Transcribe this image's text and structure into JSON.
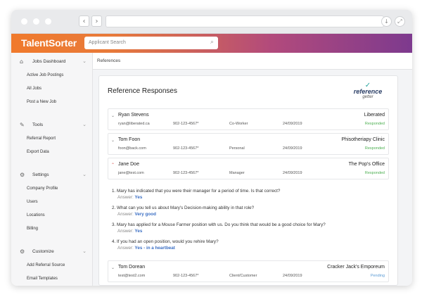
{
  "brand": {
    "name": "TalentSorter",
    "reference_logo_word": "reference",
    "reference_logo_sub": "getter"
  },
  "search": {
    "placeholder": "Applicant Search"
  },
  "breadcrumb": "References",
  "sidebar": {
    "sections": [
      {
        "label": "Jobs Dashboard",
        "icon": "home-icon",
        "items": [
          "Active Job Postings",
          "All Jobs",
          "Post a New Job"
        ]
      },
      {
        "label": "Tools",
        "icon": "wrench-icon",
        "items": [
          "Referral Report",
          "Export Data"
        ]
      },
      {
        "label": "Settings",
        "icon": "gear-icon",
        "items": [
          "Company Profile",
          "Users",
          "Locations",
          "Billing"
        ]
      },
      {
        "label": "Customize",
        "icon": "gear-icon",
        "items": [
          "Add Referral Source",
          "Email Templates"
        ]
      }
    ]
  },
  "card": {
    "title": "Reference Responses"
  },
  "references": [
    {
      "name": "Ryan Stevens",
      "email": "ryan@liberated.ca",
      "phone": "902-123-4567*",
      "relation": "Co-Worker",
      "date": "24/09/2019",
      "company": "Liberated",
      "status": "Responded"
    },
    {
      "name": "Tom Foon",
      "email": "foon@back.com",
      "phone": "902-123-4567*",
      "relation": "Personal",
      "date": "24/09/2019",
      "company": "Phisotheriapy Clinic",
      "status": "Responded"
    },
    {
      "name": "Jane Doe",
      "email": "jane@test.com",
      "phone": "902-123-4567*",
      "relation": "Manager",
      "date": "24/09/2019",
      "company": "The Pop's Office",
      "status": "Responded"
    },
    {
      "name": "Tom Dorean",
      "email": "test@test2.com",
      "phone": "902-123-4567*",
      "relation": "Client/Customer",
      "date": "24/09/2019",
      "company": "Cracker Jack's Emporeum",
      "status": "Pending"
    }
  ],
  "answer_prefix": "Answer:",
  "questions": [
    {
      "q": "1. Mary has indicated that you were their manager for a period of time. Is that correct?",
      "a": "Yes"
    },
    {
      "q": "2. What can you tell us about Mary's Decision-making ability in that role?",
      "a": "Very good"
    },
    {
      "q": "3. Mary has applied for a Mouse Farmer position with us. Do you think that would be a good choice for Mary?",
      "a": "Yes"
    },
    {
      "q": "4. If you had an open position, would you rehire Mary?",
      "a": "Yes - in a heartbeat"
    }
  ]
}
